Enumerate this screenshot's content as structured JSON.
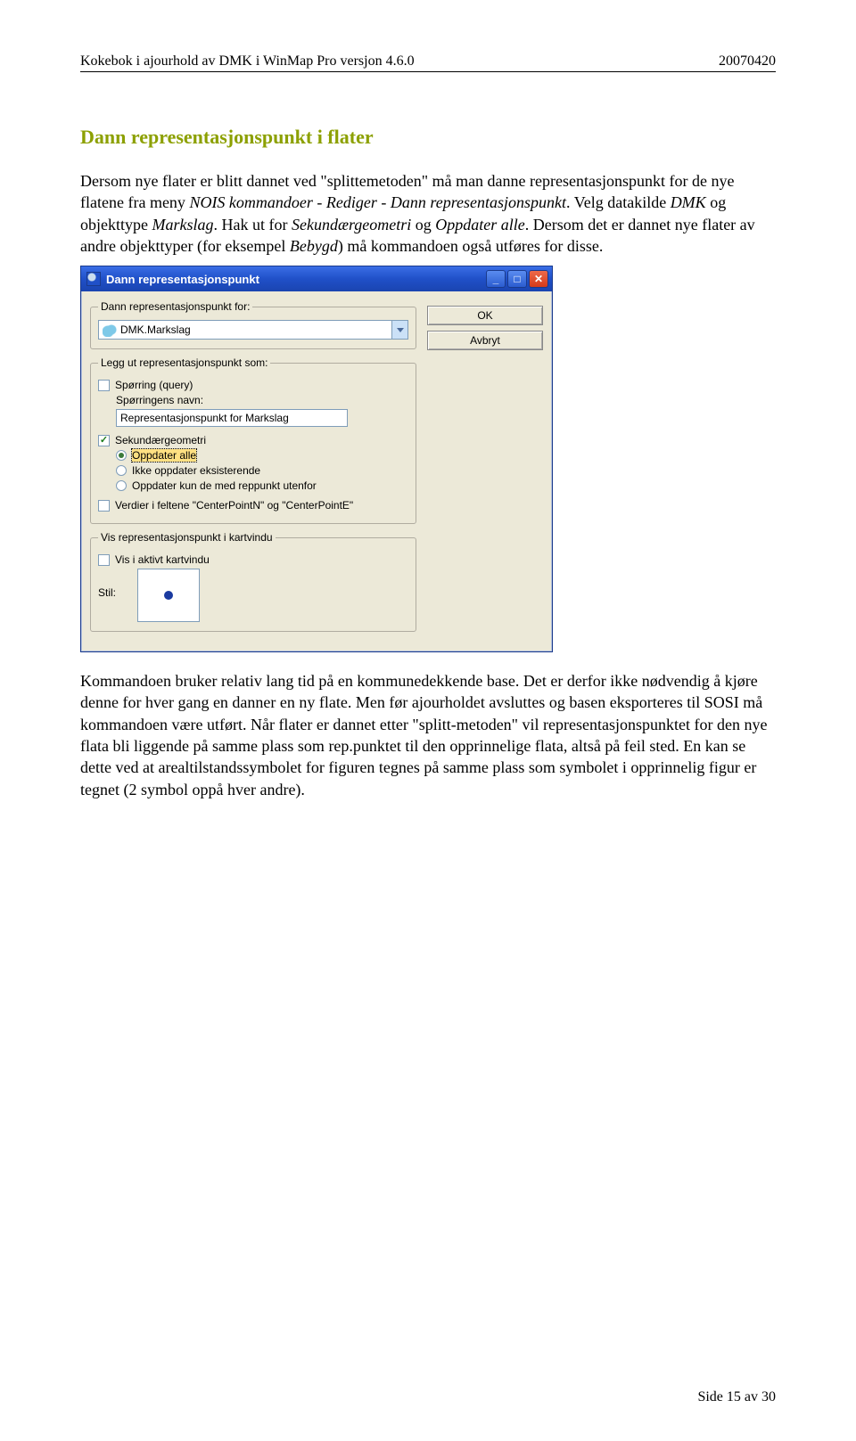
{
  "header": {
    "left": "Kokebok i ajourhold av DMK i WinMap Pro versjon 4.6.0",
    "right": "20070420"
  },
  "section_title": "Dann representasjonspunkt i flater",
  "para1_a": "Dersom nye flater er blitt dannet ved \"splittemetoden\" må man danne representasjonspunkt for de nye flatene fra meny ",
  "para1_b": "NOIS kommandoer - Rediger - Dann representasjonspunkt",
  "para1_c": ". Velg datakilde ",
  "para1_d": "DMK",
  "para1_e": " og objekttype ",
  "para1_f": "Markslag",
  "para1_g": ". Hak ut for ",
  "para1_h": "Sekundærgeometri",
  "para1_i": " og ",
  "para1_j": "Oppdater alle",
  "para1_k": ". Dersom det er dannet nye flater av andre objekttyper (for eksempel ",
  "para1_l": "Bebygd",
  "para1_m": ") må kommandoen også utføres for disse.",
  "para2": "Kommandoen bruker relativ lang tid på en kommunedekkende base. Det er derfor ikke nødvendig å kjøre denne for hver gang en danner en ny flate. Men før ajourholdet avsluttes og basen eksporteres til SOSI må kommandoen være utført. Når flater er dannet etter \"splitt-metoden\" vil representasjonspunktet for den nye flata bli liggende på samme plass som rep.punktet til den opprinnelige flata, altså på feil sted. En kan se dette ved at arealtilstandssymbolet for figuren tegnes på samme plass som symbolet i opprinnelig figur er tegnet (2 symbol oppå hver andre).",
  "dialog": {
    "title": "Dann representasjonspunkt",
    "buttons": {
      "ok": "OK",
      "cancel": "Avbryt"
    },
    "fs1": {
      "legend": "Dann representasjonspunkt for:",
      "combo": "DMK.Markslag"
    },
    "fs2": {
      "legend": "Legg ut representasjonspunkt som:",
      "query_cb": "Spørring (query)",
      "query_label": "Spørringens navn:",
      "query_value": "Representasjonspunkt for Markslag",
      "sec_cb": "Sekundærgeometri",
      "opt_all": "Oppdater alle",
      "opt_exist": "Ikke oppdater eksisterende",
      "opt_out": "Oppdater kun de med reppunkt utenfor",
      "values_cb": "Verdier i feltene \"CenterPointN\" og \"CenterPointE\""
    },
    "fs3": {
      "legend": "Vis representasjonspunkt i kartvindu",
      "show_cb": "Vis i aktivt kartvindu",
      "style": "Stil:"
    }
  },
  "footer": "Side 15 av 30"
}
